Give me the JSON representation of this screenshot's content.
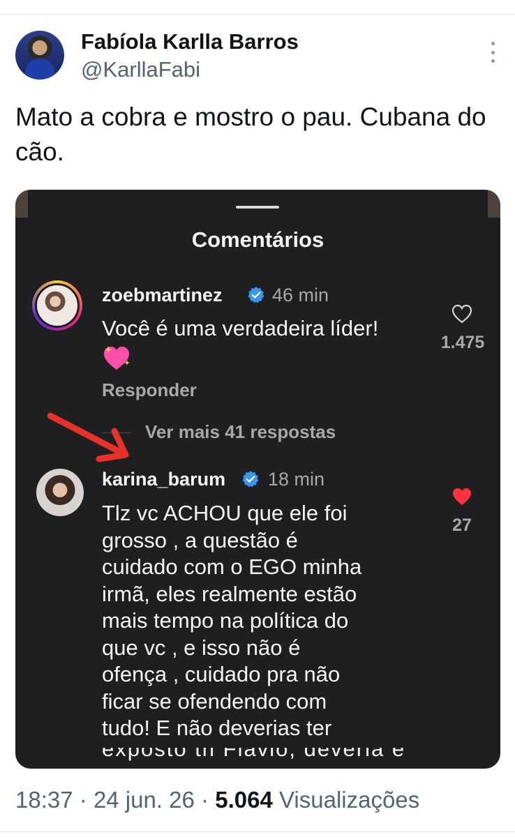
{
  "tweet": {
    "author_name": "Fabíola Karlla Barros",
    "author_handle": "@KarllaFabi",
    "text": "Mato a cobra e mostro o pau. Cubana do cão.",
    "time": "18:37",
    "date": "24 jun. 26",
    "views_count": "5.064",
    "views_label": "Visualizações",
    "separator": "·"
  },
  "screenshot": {
    "title": "Comentários",
    "comments": [
      {
        "username": "zoebmartinez",
        "verified": true,
        "time": "46 min",
        "text": "Você é uma verdadeira líder!",
        "emoji": "sparkling-heart",
        "likes": "1.475",
        "liked": false,
        "reply_label": "Responder",
        "more_replies": "Ver mais 41 respostas"
      },
      {
        "username": "karina_barum",
        "verified": true,
        "time": "18 min",
        "text_lines": [
          "Tlz vc ACHOU que ele foi",
          "grosso , a questão é",
          "cuidado com o EGO minha",
          "irmã, eles realmente estão",
          "mais tempo na política do",
          "que vc , e isso não é",
          "ofença , cuidado pra não",
          "ficar se ofendendo com",
          "tudo! E não deverias ter"
        ],
        "cut_line": "exposto th Flavio, deveria é",
        "likes": "27",
        "liked": true
      }
    ]
  },
  "colors": {
    "sheet_background": "#1f1f21",
    "verified_blue": "#3797f0",
    "liked_red": "#ff3040",
    "arrow_red": "#e8312a"
  }
}
